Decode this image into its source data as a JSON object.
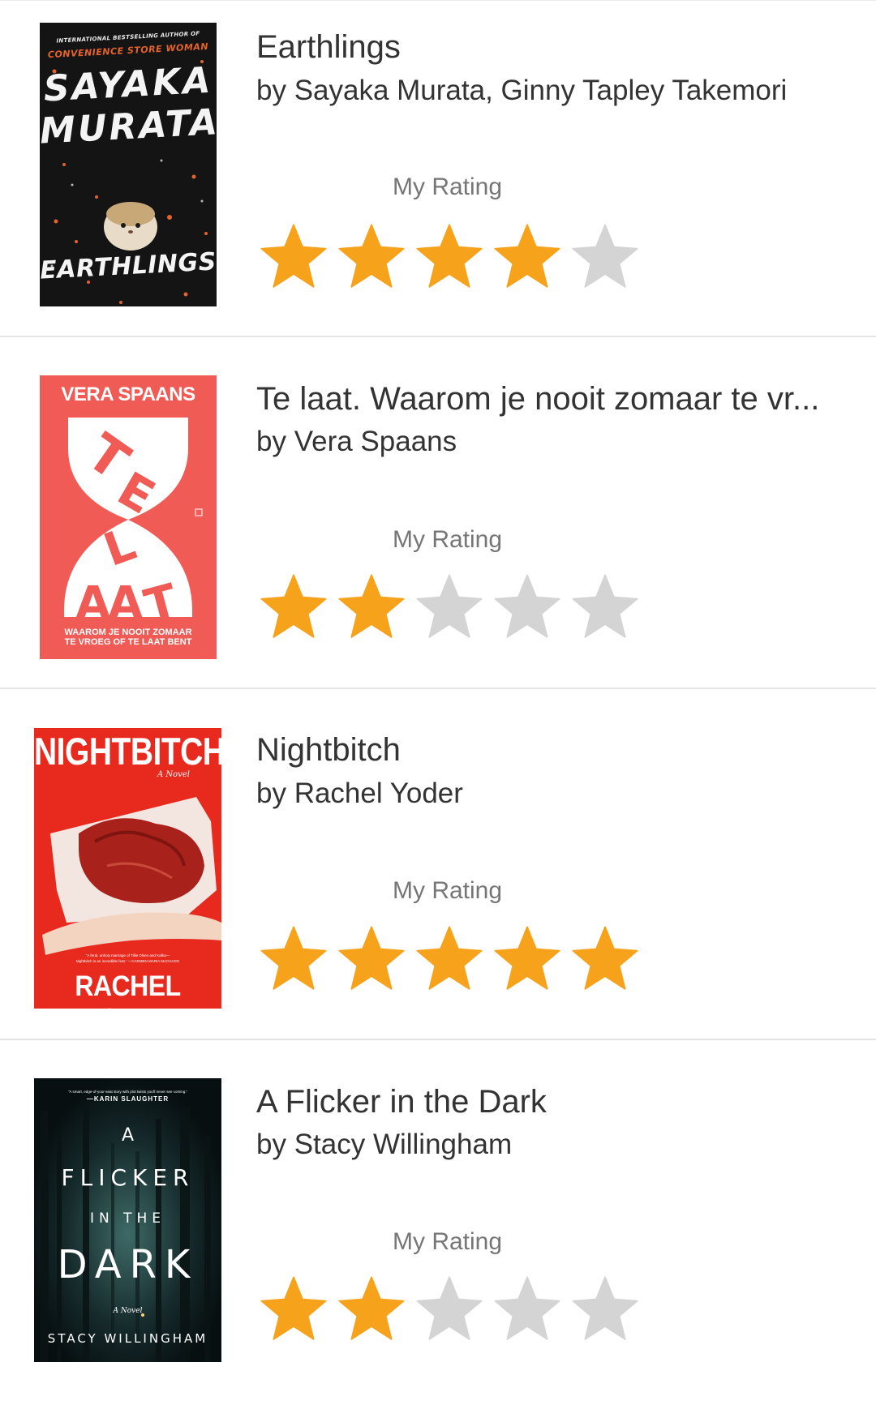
{
  "colors": {
    "star_filled": "#f7a21b",
    "star_empty": "#d4d4d4",
    "divider": "#e4e4e4",
    "title_text": "#333333",
    "label_text": "#767676"
  },
  "books": [
    {
      "title": "Earthlings",
      "author": "by Sayaka Murata, Ginny Tapley Takemori",
      "rating_label": "My Rating",
      "rating": 4,
      "max_rating": 5,
      "cover": {
        "top_line": "INTERNATIONAL BESTSELLING AUTHOR OF",
        "subtitle": "CONVENIENCE STORE WOMAN",
        "author_line1": "SAYAKA",
        "author_line2": "MURATA",
        "title": "EARTHLINGS"
      }
    },
    {
      "title": "Te laat. Waarom je nooit zomaar te vr...",
      "author": "by Vera Spaans",
      "rating_label": "My Rating",
      "rating": 2,
      "max_rating": 5,
      "cover": {
        "author": "VERA SPAANS",
        "title_top": "TE",
        "title_bottom": "LAAT",
        "subtitle_line1": "WAAROM JE NOOIT ZOMAAR",
        "subtitle_line2": "TE VROEG OF TE LAAT BENT"
      }
    },
    {
      "title": "Nightbitch",
      "author": "by Rachel Yoder",
      "rating_label": "My Rating",
      "rating": 5,
      "max_rating": 5,
      "cover": {
        "title": "NIGHTBITCH",
        "tagline": "A Novel",
        "blurb_line1": "\"A feral, unholy marriage of Tillie Olsen and Kafka—",
        "blurb_line2": "Nightbitch is an incredible feat.\" —CARMEN MARIA MACHADO",
        "author": "RACHEL YODER"
      }
    },
    {
      "title": "A Flicker in the Dark",
      "author": "by Stacy Willingham",
      "rating_label": "My Rating",
      "rating": 2,
      "max_rating": 5,
      "cover": {
        "blurb": "\"A smart, edge-of-your-seat story with plot twists you'll never see coming.\"",
        "blurb_author": "—KARIN SLAUGHTER",
        "title_a": "A",
        "title_flicker": "FLICKER",
        "title_inthe": "IN THE",
        "title_dark": "DARK",
        "tagline": "A Novel",
        "author": "STACY WILLINGHAM"
      }
    }
  ]
}
